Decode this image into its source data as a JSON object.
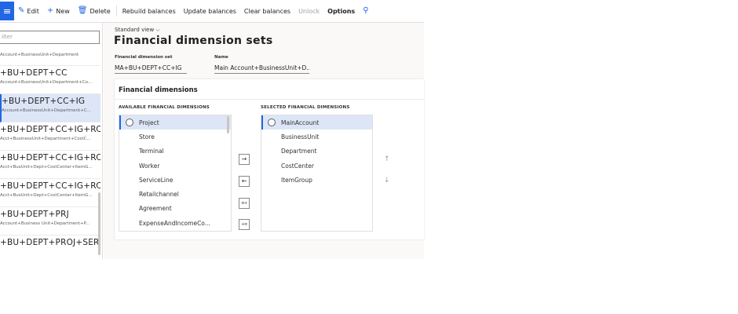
{
  "toolbar": {
    "edit": "Edit",
    "new": "New",
    "delete": "Delete",
    "rebuild_balances": "Rebuild balances",
    "update_balances": "Update balances",
    "clear_balances": "Clear balances",
    "unlock": "Unlock",
    "options": "Options"
  },
  "filter": {
    "placeholder": "ilter"
  },
  "list": [
    {
      "title": "",
      "subtitle": "Account+BusinessUnit+Department"
    },
    {
      "title": "+BU+DEPT+CC",
      "subtitle": "Account+BusinessUnit+Department+Co..."
    },
    {
      "title": "+BU+DEPT+CC+IG",
      "subtitle": "Account+BusinessUnit+Department+C..."
    },
    {
      "title": "+BU+DEPT+CC+IG+RC",
      "subtitle": "Acct+BusinessUnit+Department+CostC..."
    },
    {
      "title": "+BU+DEPT+CC+IG+RC+...",
      "subtitle": "Acct+BusUnit+Dept+CostCenter+ItemG..."
    },
    {
      "title": "+BU+DEPT+CC+IG+RC+...",
      "subtitle": "Acct+BusUnit+Dept+CostCenter+ItemG..."
    },
    {
      "title": "+BU+DEPT+PRJ",
      "subtitle": "Account+Business Unit+Department+P..."
    },
    {
      "title": "+BU+DEPT+PROJ+SERV...",
      "subtitle": ""
    }
  ],
  "main": {
    "view": "Standard view",
    "title": "Financial dimension sets",
    "set_label": "Financial dimension set",
    "set_value": "MA+BU+DEPT+CC+IG",
    "name_label": "Name",
    "name_value": "Main Account+BusinessUnit+D..."
  },
  "card": {
    "title": "Financial dimensions",
    "available_header": "AVAILABLE FINANCIAL DIMENSIONS",
    "selected_header": "SELECTED FINANCIAL DIMENSIONS",
    "available": [
      "Project",
      "Store",
      "Terminal",
      "Worker",
      "ServiceLine",
      "Retailchannel",
      "Agreement",
      "ExpenseAndIncomeCo..."
    ],
    "selected": [
      "MainAccount",
      "BusinessUnit",
      "Department",
      "CostCenter",
      "ItemGroup"
    ],
    "buttons": {
      "add": "→",
      "remove": "←",
      "add_all": "≡+",
      "remove_all": "+≡"
    },
    "move_up": "↑",
    "move_down": "↓"
  },
  "colors": {
    "accent": "#2266e3",
    "selected_bg": "#dce6f7"
  }
}
